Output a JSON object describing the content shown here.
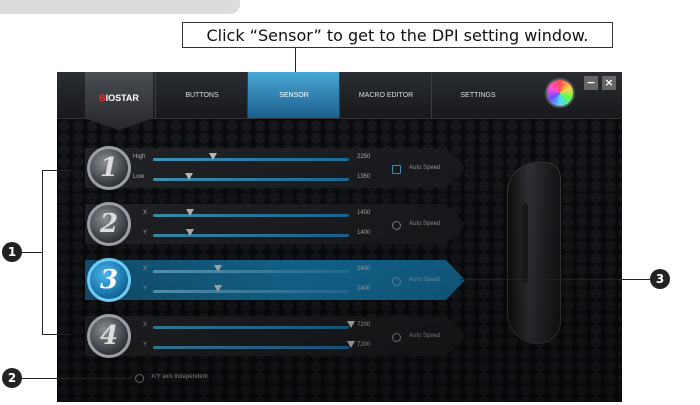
{
  "callout": "Click “Sensor” to get to the DPI setting window.",
  "brand": {
    "logo_b": "B",
    "logo_rest": "IOSTAR"
  },
  "tabs": [
    "BUTTONS",
    "SENSOR",
    "MACRO EDITOR",
    "SETTINGS"
  ],
  "active_tab": "SENSOR",
  "window": {
    "minimize": "−",
    "close": "×"
  },
  "profiles": [
    {
      "number": "1",
      "label_a": "High",
      "label_b": "Low",
      "value_a": "2250",
      "value_b": "1350",
      "auto_speed": "Auto Speed",
      "auto_checked": true
    },
    {
      "number": "2",
      "label_a": "X",
      "label_b": "Y",
      "value_a": "1400",
      "value_b": "1400",
      "auto_speed": "Auto Speed",
      "auto_checked": false
    },
    {
      "number": "3",
      "label_a": "X",
      "label_b": "Y",
      "value_a": "2400",
      "value_b": "2400",
      "auto_speed": "Auto Speed",
      "auto_checked": false
    },
    {
      "number": "4",
      "label_a": "X",
      "label_b": "Y",
      "value_a": "7200",
      "value_b": "7200",
      "auto_speed": "Auto Speed",
      "auto_checked": false
    }
  ],
  "xy_independent": "X/Y axis independent",
  "markers": [
    "1",
    "2",
    "3"
  ],
  "colors": {
    "accent": "#1a8ec6",
    "background": "#0b0d10"
  }
}
